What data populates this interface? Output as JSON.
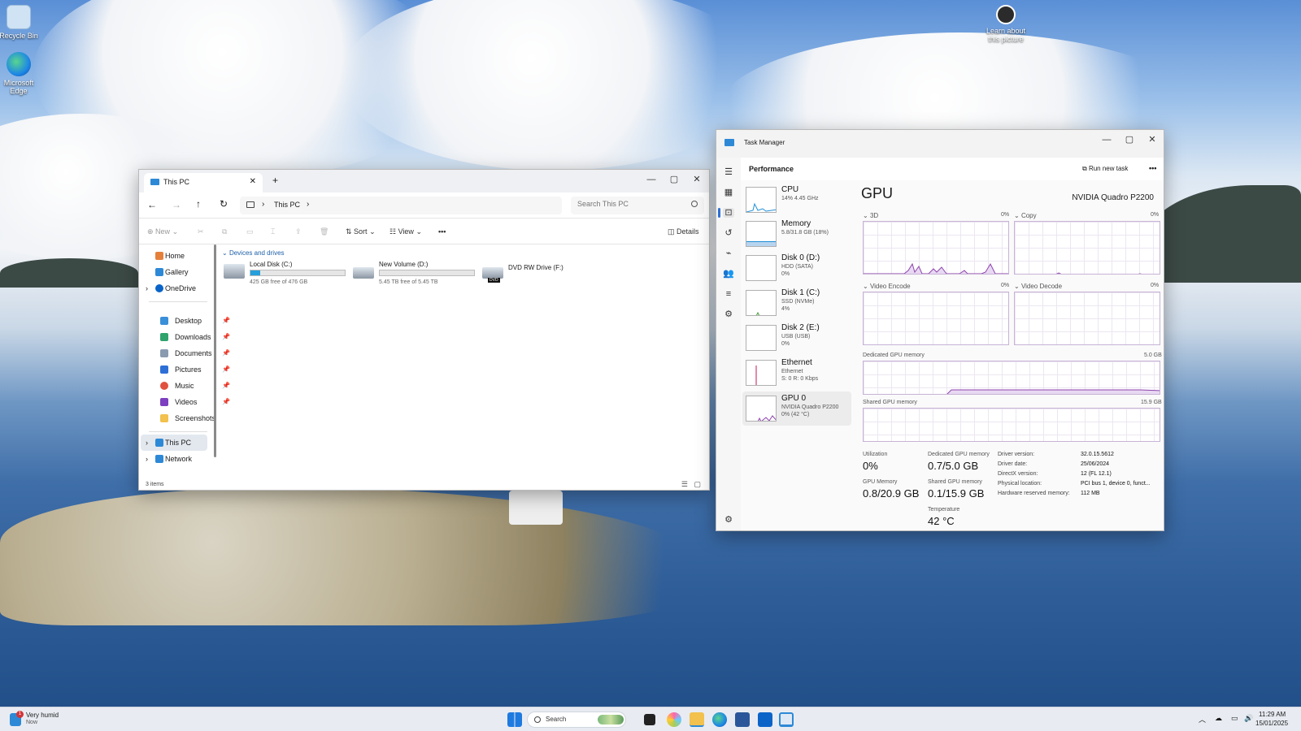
{
  "desktop": {
    "icons": [
      {
        "label": "Recycle Bin"
      },
      {
        "label": "Microsoft Edge"
      },
      {
        "label": "Learn about this picture"
      }
    ]
  },
  "explorer": {
    "tab_title": "This PC",
    "breadcrumb": "This PC",
    "search_placeholder": "Search This PC",
    "toolbar": {
      "new": "New",
      "sort": "Sort",
      "view": "View",
      "more": "•••",
      "details": "Details"
    },
    "nav": {
      "home": "Home",
      "gallery": "Gallery",
      "onedrive": "OneDrive",
      "desktop": "Desktop",
      "downloads": "Downloads",
      "documents": "Documents",
      "pictures": "Pictures",
      "music": "Music",
      "videos": "Videos",
      "screenshots": "Screenshots",
      "this_pc": "This PC",
      "network": "Network"
    },
    "section": "Devices and drives",
    "drives": [
      {
        "name": "Local Disk (C:)",
        "info": "425 GB free of 476 GB",
        "used_fraction": 0.107
      },
      {
        "name": "New Volume (D:)",
        "info": "5.45 TB free of 5.45 TB",
        "used_fraction": 0.0
      },
      {
        "name": "DVD RW Drive (F:)",
        "badge": "DVD"
      }
    ],
    "status": "3 items"
  },
  "taskmgr": {
    "title": "Task Manager",
    "section": "Performance",
    "run_new_task": "Run new task",
    "more": "•••",
    "items": [
      {
        "name": "CPU",
        "s1": "14% 4.45 GHz",
        "s2": ""
      },
      {
        "name": "Memory",
        "s1": "5.8/31.8 GB (18%)",
        "s2": ""
      },
      {
        "name": "Disk 0 (D:)",
        "s1": "HDD (SATA)",
        "s2": "0%"
      },
      {
        "name": "Disk 1 (C:)",
        "s1": "SSD (NVMe)",
        "s2": "4%"
      },
      {
        "name": "Disk 2 (E:)",
        "s1": "USB (USB)",
        "s2": "0%"
      },
      {
        "name": "Ethernet",
        "s1": "Ethernet",
        "s2": "S: 0 R: 0 Kbps"
      },
      {
        "name": "GPU 0",
        "s1": "NVIDIA Quadro P2200",
        "s2": "0% (42 °C)"
      }
    ],
    "gpu": {
      "heading": "GPU",
      "model": "NVIDIA Quadro P2200",
      "engines": [
        {
          "name": "3D",
          "pct": "0%"
        },
        {
          "name": "Copy",
          "pct": "0%"
        },
        {
          "name": "Video Encode",
          "pct": "0%"
        },
        {
          "name": "Video Decode",
          "pct": "0%"
        }
      ],
      "dedicated_label": "Dedicated GPU memory",
      "dedicated_max": "5.0 GB",
      "shared_label": "Shared GPU memory",
      "shared_max": "15.9 GB",
      "stats": {
        "utilization_label": "Utilization",
        "utilization": "0%",
        "dedicated_label": "Dedicated GPU memory",
        "dedicated": "0.7/5.0 GB",
        "gpu_memory_label": "GPU Memory",
        "gpu_memory": "0.8/20.9 GB",
        "shared_label": "Shared GPU memory",
        "shared": "0.1/15.9 GB",
        "temp_label": "Temperature",
        "temp": "42 °C"
      },
      "details": [
        {
          "k": "Driver version:",
          "v": "32.0.15.5612"
        },
        {
          "k": "Driver date:",
          "v": "25/06/2024"
        },
        {
          "k": "DirectX version:",
          "v": "12 (FL 12.1)"
        },
        {
          "k": "Physical location:",
          "v": "PCI bus 1, device 0, funct..."
        },
        {
          "k": "Hardware reserved memory:",
          "v": "112 MB"
        }
      ]
    }
  },
  "taskbar": {
    "weather_title": "Very humid",
    "weather_sub": "Now",
    "weather_badge": "1",
    "search": "Search",
    "time": "11:29 AM",
    "date": "15/01/2025"
  }
}
